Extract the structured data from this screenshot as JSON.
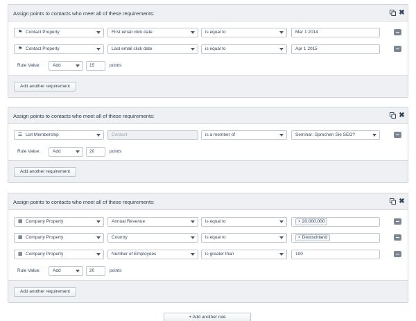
{
  "rules": [
    {
      "title": "Assign points to contacts who meet all of these requirements:",
      "requirements": [
        {
          "type_icon": "flag-icon",
          "type": "Contact Property",
          "property": "First email click date",
          "operator": "is equal to",
          "value": "Mar 1 2014"
        },
        {
          "type_icon": "flag-icon",
          "type": "Contact Property",
          "property": "Last email click date",
          "operator": "is equal to",
          "value": "Apr 1 2015"
        }
      ],
      "rule_value": {
        "label": "Rule Value:",
        "action": "Add",
        "points": "15",
        "unit": "points"
      },
      "add_requirement_label": "Add another requirement"
    },
    {
      "title": "Assign points to contacts who meet all of these requirements:",
      "requirements": [
        {
          "type_icon": "list-icon",
          "type": "List Membership",
          "property_placeholder": "Contact",
          "operator": "is a member of",
          "value": "Seminar: Sprechen Sie SEO?"
        }
      ],
      "rule_value": {
        "label": "Rule Value:",
        "action": "Add",
        "points": "20",
        "unit": "points"
      },
      "add_requirement_label": "Add another requirement"
    },
    {
      "title": "Assign points to contacts who meet all of these requirements:",
      "requirements": [
        {
          "type_icon": "building-icon",
          "type": "Company Property",
          "property": "Annual Revenue",
          "operator": "is equal to",
          "value": "20.000.000"
        },
        {
          "type_icon": "building-icon",
          "type": "Company Property",
          "property": "Country",
          "operator": "is equal to",
          "value": "Deutschland"
        },
        {
          "type_icon": "building-icon",
          "type": "Company Property",
          "property": "Number of Employees",
          "operator": "is greater than",
          "value": "100"
        }
      ],
      "rule_value": {
        "label": "Rule Value:",
        "action": "Add",
        "points": "20",
        "unit": "points"
      },
      "add_requirement_label": "Add another requirement"
    }
  ],
  "add_rule_label": "+ Add another rule",
  "colors": {
    "header_bg": "#eef0f3",
    "border": "#cfd4d9",
    "text": "#33475b",
    "remove_button": "#7c8793"
  }
}
